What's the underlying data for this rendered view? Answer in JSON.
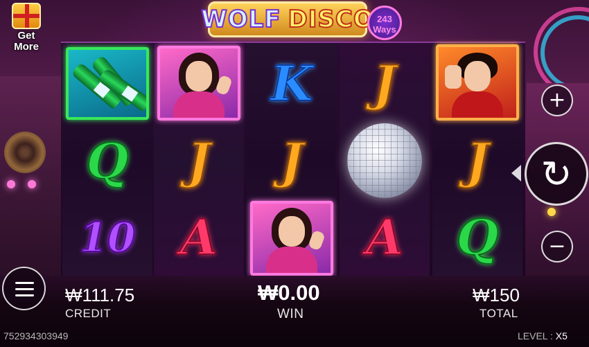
{
  "logo": {
    "word1": "WOLF",
    "word2": "DISCO",
    "ways_count": "243",
    "ways_label": "Ways"
  },
  "promo": {
    "line1": "Get",
    "line2": "More"
  },
  "reels": [
    [
      "bottles",
      "Q",
      "10"
    ],
    [
      "woman",
      "J",
      "A"
    ],
    [
      "K",
      "J",
      "woman"
    ],
    [
      "J",
      "disco-ball",
      "A"
    ],
    [
      "man",
      "J",
      "Q"
    ]
  ],
  "meter": {
    "credit_value": "₩111.75",
    "credit_label": "CREDIT",
    "win_value": "₩0.00",
    "win_label": "WIN",
    "total_value": "₩150",
    "total_label": "TOTAL"
  },
  "footer": {
    "session_id": "752934303949",
    "level_label": "LEVEL :",
    "level_value": "X5"
  },
  "controls": {
    "plus": "+",
    "minus": "−",
    "spin": "↻"
  },
  "colors": {
    "accent_pink": "#ff7ae0",
    "accent_gold": "#ffa820",
    "background": "#3b1238"
  }
}
